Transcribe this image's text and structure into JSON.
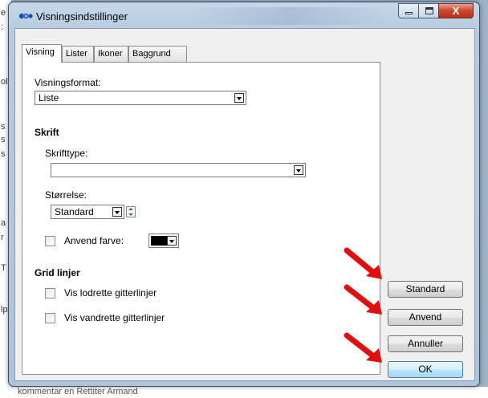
{
  "window": {
    "title": "Visningsindstillinger",
    "controls": {
      "close_glyph": "X"
    }
  },
  "tabs": [
    {
      "label": "Visning"
    },
    {
      "label": "Lister"
    },
    {
      "label": "Ikoner"
    },
    {
      "label": "Baggrund"
    }
  ],
  "visning": {
    "format_label": "Visningsformat:",
    "format_value": "Liste",
    "font_heading": "Skrift",
    "fonttype_label": "Skrifttype:",
    "fonttype_value": "",
    "size_label": "Størrelse:",
    "size_value": "Standard",
    "use_color_label": "Anvend farve:",
    "use_color_checked": false,
    "color_value": "#000000",
    "grid_heading": "Grid linjer",
    "vertical_label": "Vis lodrette gitterlinjer",
    "vertical_checked": false,
    "horizontal_label": "Vis vandrette gitterlinjer",
    "horizontal_checked": false
  },
  "buttons": {
    "standard": "Standard",
    "apply": "Anvend",
    "cancel": "Annuller",
    "ok": "OK"
  },
  "annotations": {
    "arrow_color": "#e01010",
    "arrow_icon": "red-arrow-icon"
  },
  "background": {
    "left_strip_chars": [
      "e",
      ":",
      "ol",
      "s",
      "s",
      "s",
      "a",
      "r",
      "T",
      "lp"
    ],
    "bottom_text": "kommentar en Rettiter Armand"
  }
}
